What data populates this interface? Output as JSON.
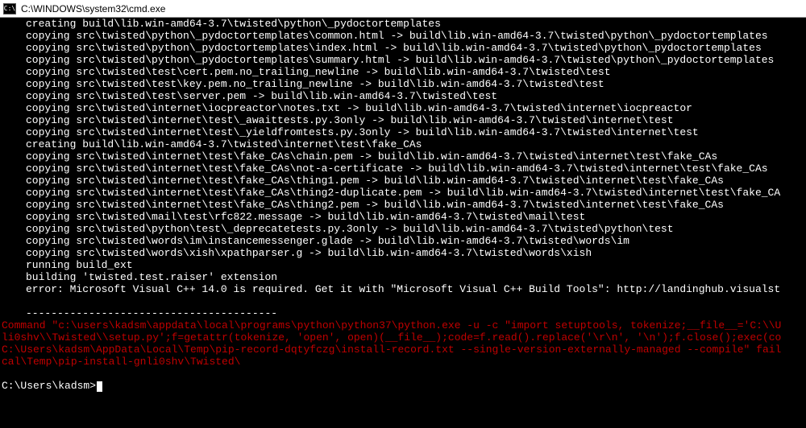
{
  "titlebar": {
    "icon_label": "C:\\",
    "title": "C:\\WINDOWS\\system32\\cmd.exe"
  },
  "lines": [
    {
      "cls": "indent",
      "text": "creating build\\lib.win-amd64-3.7\\twisted\\python\\_pydoctortemplates"
    },
    {
      "cls": "indent",
      "text": "copying src\\twisted\\python\\_pydoctortemplates\\common.html -> build\\lib.win-amd64-3.7\\twisted\\python\\_pydoctortemplates"
    },
    {
      "cls": "indent",
      "text": "copying src\\twisted\\python\\_pydoctortemplates\\index.html -> build\\lib.win-amd64-3.7\\twisted\\python\\_pydoctortemplates"
    },
    {
      "cls": "indent",
      "text": "copying src\\twisted\\python\\_pydoctortemplates\\summary.html -> build\\lib.win-amd64-3.7\\twisted\\python\\_pydoctortemplates"
    },
    {
      "cls": "indent",
      "text": "copying src\\twisted\\test\\cert.pem.no_trailing_newline -> build\\lib.win-amd64-3.7\\twisted\\test"
    },
    {
      "cls": "indent",
      "text": "copying src\\twisted\\test\\key.pem.no_trailing_newline -> build\\lib.win-amd64-3.7\\twisted\\test"
    },
    {
      "cls": "indent",
      "text": "copying src\\twisted\\test\\server.pem -> build\\lib.win-amd64-3.7\\twisted\\test"
    },
    {
      "cls": "indent",
      "text": "copying src\\twisted\\internet\\iocpreactor\\notes.txt -> build\\lib.win-amd64-3.7\\twisted\\internet\\iocpreactor"
    },
    {
      "cls": "indent",
      "text": "copying src\\twisted\\internet\\test\\_awaittests.py.3only -> build\\lib.win-amd64-3.7\\twisted\\internet\\test"
    },
    {
      "cls": "indent",
      "text": "copying src\\twisted\\internet\\test\\_yieldfromtests.py.3only -> build\\lib.win-amd64-3.7\\twisted\\internet\\test"
    },
    {
      "cls": "indent",
      "text": "creating build\\lib.win-amd64-3.7\\twisted\\internet\\test\\fake_CAs"
    },
    {
      "cls": "indent",
      "text": "copying src\\twisted\\internet\\test\\fake_CAs\\chain.pem -> build\\lib.win-amd64-3.7\\twisted\\internet\\test\\fake_CAs"
    },
    {
      "cls": "indent",
      "text": "copying src\\twisted\\internet\\test\\fake_CAs\\not-a-certificate -> build\\lib.win-amd64-3.7\\twisted\\internet\\test\\fake_CAs"
    },
    {
      "cls": "indent",
      "text": "copying src\\twisted\\internet\\test\\fake_CAs\\thing1.pem -> build\\lib.win-amd64-3.7\\twisted\\internet\\test\\fake_CAs"
    },
    {
      "cls": "indent",
      "text": "copying src\\twisted\\internet\\test\\fake_CAs\\thing2-duplicate.pem -> build\\lib.win-amd64-3.7\\twisted\\internet\\test\\fake_CA"
    },
    {
      "cls": "indent",
      "text": "copying src\\twisted\\internet\\test\\fake_CAs\\thing2.pem -> build\\lib.win-amd64-3.7\\twisted\\internet\\test\\fake_CAs"
    },
    {
      "cls": "indent",
      "text": "copying src\\twisted\\mail\\test\\rfc822.message -> build\\lib.win-amd64-3.7\\twisted\\mail\\test"
    },
    {
      "cls": "indent",
      "text": "copying src\\twisted\\python\\test\\_deprecatetests.py.3only -> build\\lib.win-amd64-3.7\\twisted\\python\\test"
    },
    {
      "cls": "indent",
      "text": "copying src\\twisted\\words\\im\\instancemessenger.glade -> build\\lib.win-amd64-3.7\\twisted\\words\\im"
    },
    {
      "cls": "indent",
      "text": "copying src\\twisted\\words\\xish\\xpathparser.g -> build\\lib.win-amd64-3.7\\twisted\\words\\xish"
    },
    {
      "cls": "indent",
      "text": "running build_ext"
    },
    {
      "cls": "indent",
      "text": "building 'twisted.test.raiser' extension"
    },
    {
      "cls": "indent",
      "text": "error: Microsoft Visual C++ 14.0 is required. Get it with \"Microsoft Visual C++ Build Tools\": http://landinghub.visualst"
    },
    {
      "cls": "blank",
      "text": " "
    },
    {
      "cls": "indent",
      "text": "----------------------------------------"
    },
    {
      "cls": "red",
      "text": "Command \"c:\\users\\kadsm\\appdata\\local\\programs\\python\\python37\\python.exe -u -c \"import setuptools, tokenize;__file__='C:\\\\U"
    },
    {
      "cls": "red",
      "text": "li0shv\\\\Twisted\\\\setup.py';f=getattr(tokenize, 'open', open)(__file__);code=f.read().replace('\\r\\n', '\\n');f.close();exec(co"
    },
    {
      "cls": "red",
      "text": "C:\\Users\\kadsm\\AppData\\Local\\Temp\\pip-record-dqtyfczg\\install-record.txt --single-version-externally-managed --compile\" fail"
    },
    {
      "cls": "red",
      "text": "cal\\Temp\\pip-install-gnli0shv\\Twisted\\"
    },
    {
      "cls": "blank",
      "text": " "
    }
  ],
  "prompt": "C:\\Users\\kadsm>"
}
